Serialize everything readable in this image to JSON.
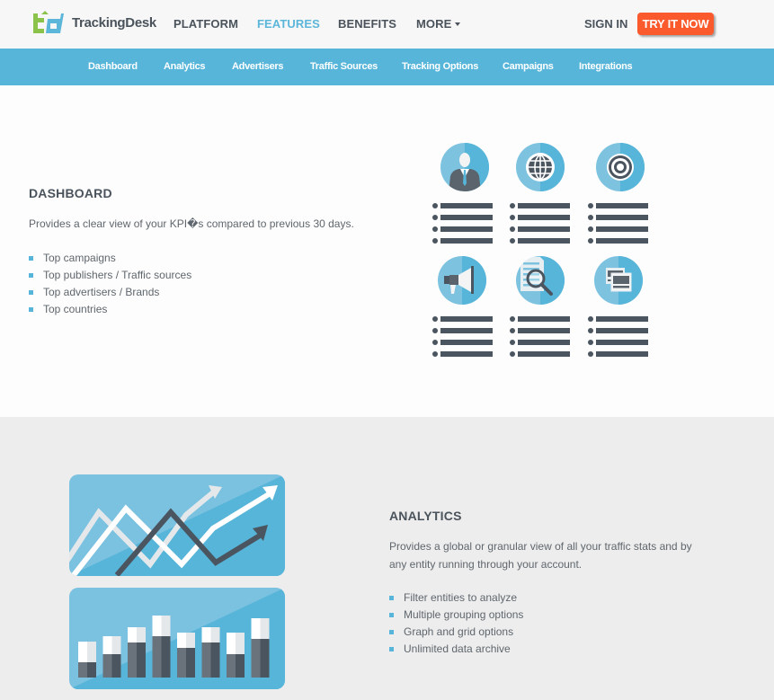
{
  "header": {
    "brand": "TrackingDesk",
    "nav": [
      {
        "label": "PLATFORM",
        "active": false
      },
      {
        "label": "FEATURES",
        "active": true
      },
      {
        "label": "BENEFITS",
        "active": false
      },
      {
        "label": "MORE",
        "active": false,
        "has_dropdown": true
      }
    ],
    "sign_in": "SIGN IN",
    "cta": "TRY IT NOW"
  },
  "subnav": {
    "items": [
      "Dashboard",
      "Analytics",
      "Advertisers",
      "Traffic Sources",
      "Tracking Options",
      "Campaigns",
      "Integrations"
    ]
  },
  "sections": [
    {
      "title": "DASHBOARD",
      "description": "Provides a clear view of your KPI�s compared to previous 30 days.",
      "bullets": [
        "Top campaigns",
        "Top publishers / Traffic sources",
        "Top advertisers / Brands",
        "Top countries"
      ],
      "illustration_icons": [
        "user-icon",
        "globe-icon",
        "target-icon",
        "megaphone-icon",
        "search-document-icon",
        "windows-icon"
      ]
    },
    {
      "title": "ANALYTICS",
      "description": "Provides a global or granular view of all your traffic stats and by any entity running through your account.",
      "bullets": [
        "Filter entities to analyze",
        "Multiple grouping options",
        "Graph and grid options",
        "Unlimited data archive"
      ],
      "illustration_icons": [
        "line-chart-icon",
        "bar-chart-icon"
      ]
    }
  ],
  "colors": {
    "accent": "#56b5d9",
    "cta": "#fa5a2c",
    "text_dark": "#4a535c",
    "logo_green": "#8bc34a",
    "section_alt_bg": "#ededed"
  }
}
